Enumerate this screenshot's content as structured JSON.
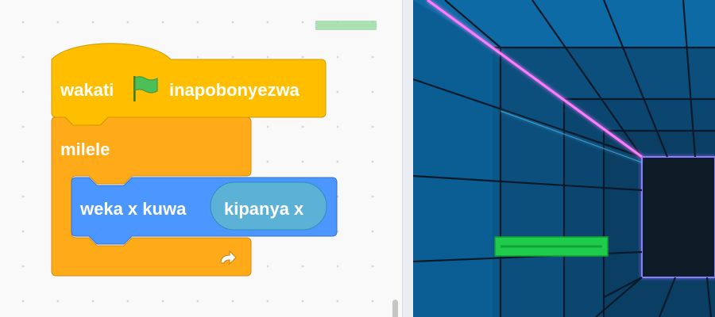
{
  "workspace": {
    "hat_block": {
      "label_before": "wakati",
      "icon": "green-flag-icon",
      "label_after": "inapobonyezwa",
      "color": "#ffbf00"
    },
    "forever_block": {
      "label": "milele",
      "loop_icon": "loop-arrow-icon",
      "color": "#ffab19"
    },
    "motion_block": {
      "label": "weka x kuwa",
      "reporter_label": "kipanya x",
      "color": "#4c97ff",
      "reporter_color": "#5cb1d6"
    }
  },
  "stage": {
    "paddle_color": "#1fcb4a",
    "wall_color": "#0b5e93",
    "end_color": "#071a26",
    "laser_color": "#ff7bff"
  }
}
